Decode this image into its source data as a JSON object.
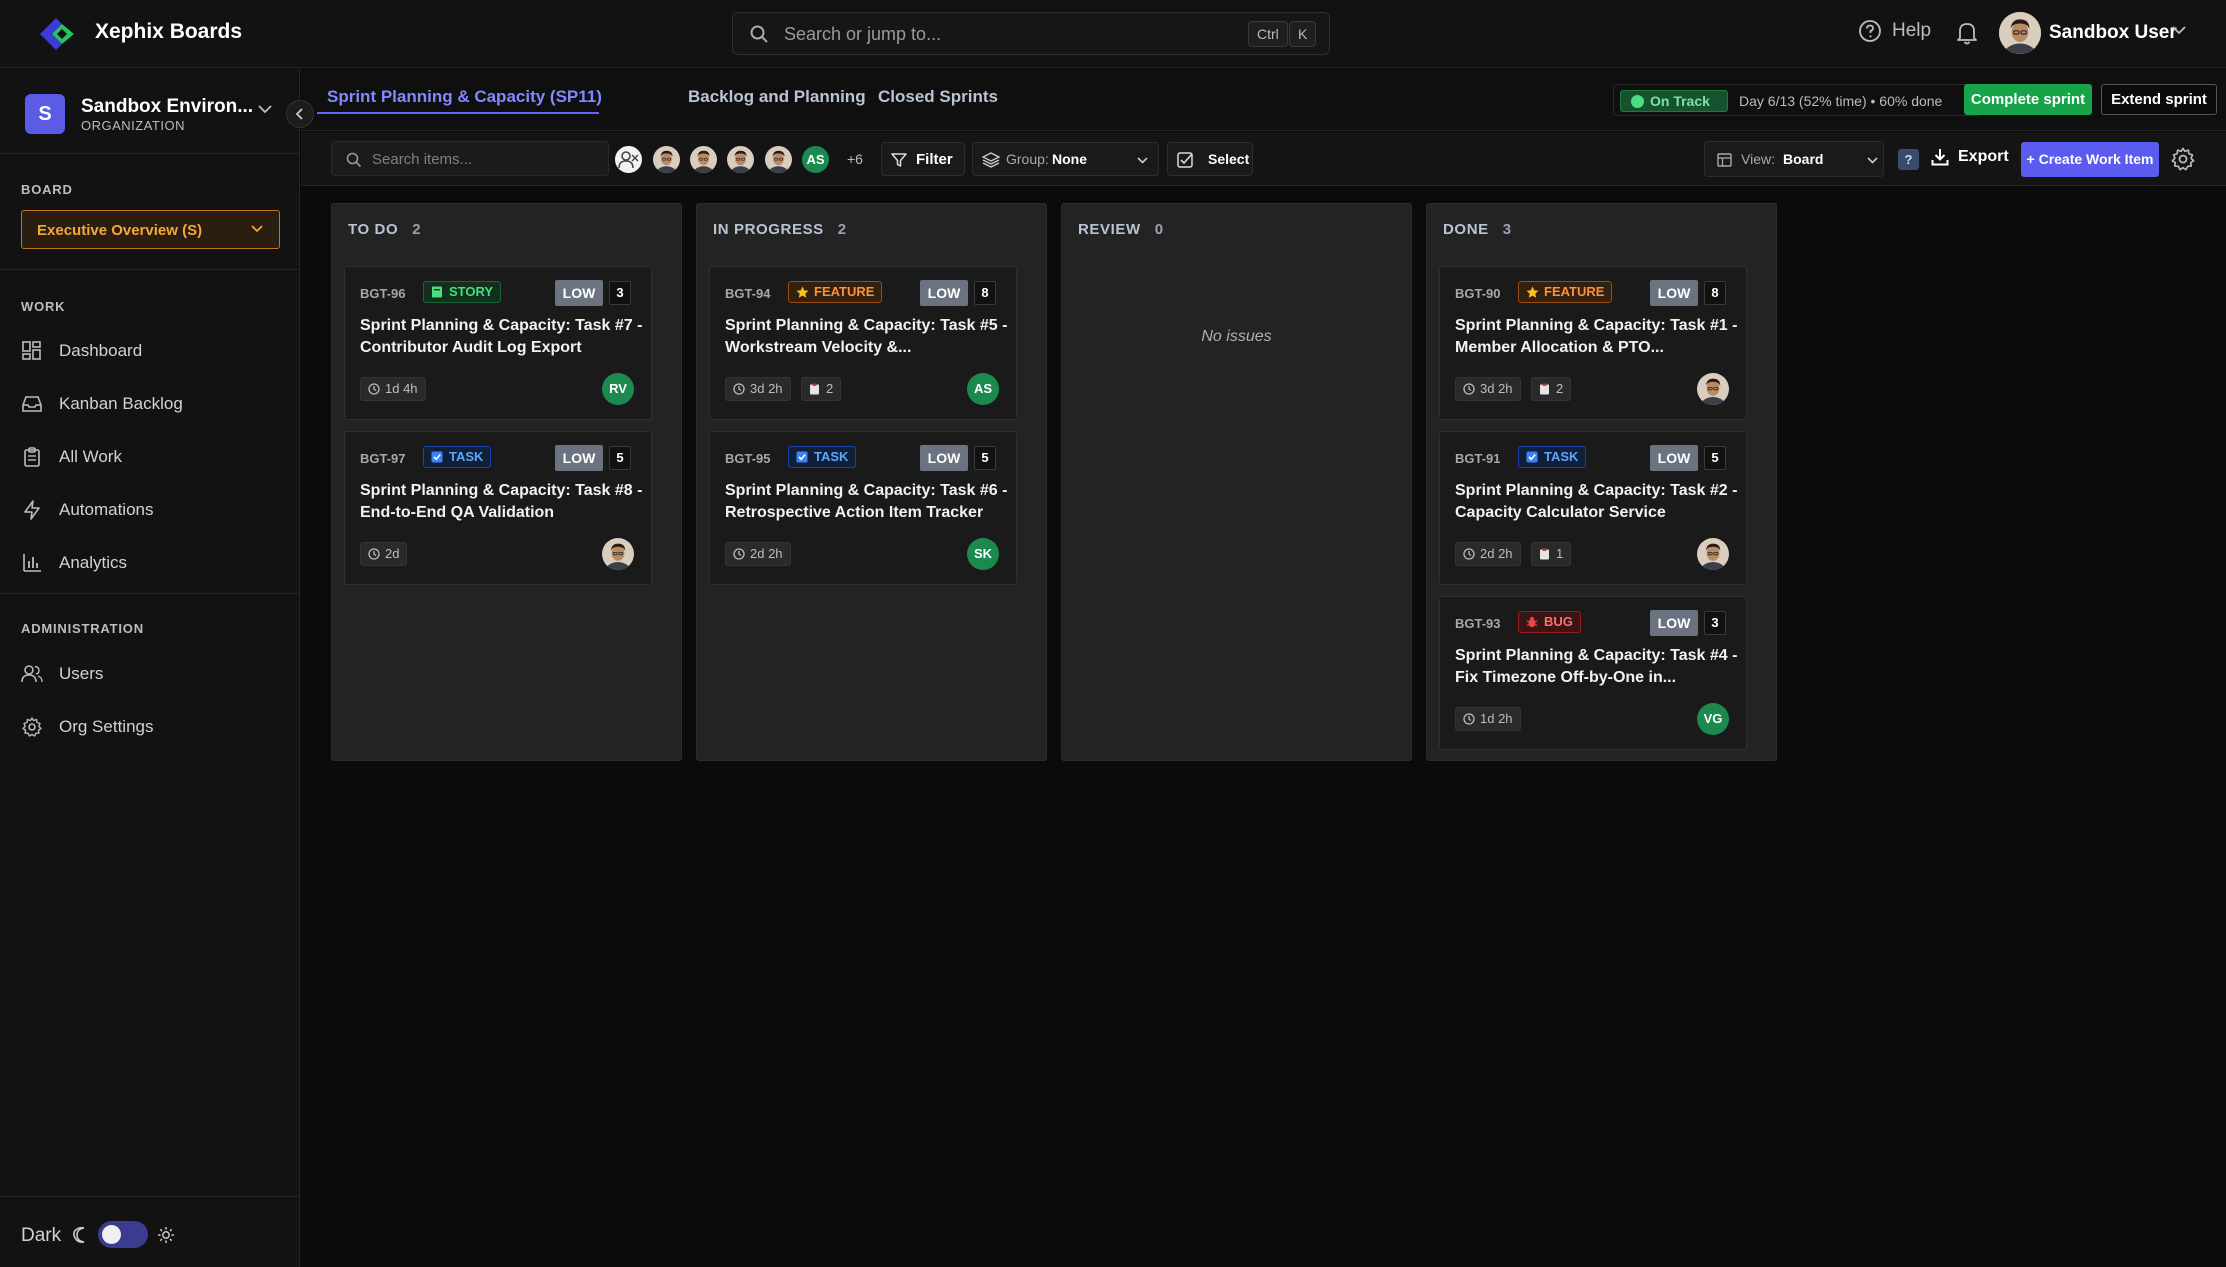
{
  "app": {
    "title": "Xephix Boards",
    "search_placeholder": "Search or jump to...",
    "shortcut_keys": [
      "Ctrl",
      "K"
    ],
    "help_label": "Help",
    "user_name": "Sandbox User"
  },
  "sidebar": {
    "org_initial": "S",
    "org_name": "Sandbox Environ...",
    "org_type": "ORGANIZATION",
    "board_label": "BOARD",
    "board_value": "Executive Overview (S)",
    "work_label": "WORK",
    "work_items": [
      {
        "label": "Dashboard",
        "icon": "dashboard-icon"
      },
      {
        "label": "Kanban Backlog",
        "icon": "inbox-icon"
      },
      {
        "label": "All Work",
        "icon": "clipboard-icon"
      },
      {
        "label": "Automations",
        "icon": "lightning-icon"
      },
      {
        "label": "Analytics",
        "icon": "bar-chart-icon"
      }
    ],
    "admin_label": "ADMINISTRATION",
    "admin_items": [
      {
        "label": "Users",
        "icon": "users-icon"
      },
      {
        "label": "Org Settings",
        "icon": "gear-icon"
      }
    ],
    "theme_label": "Dark"
  },
  "sprint": {
    "tabs": [
      "Sprint Planning & Capacity (SP11)",
      "Backlog and Planning",
      "Closed Sprints"
    ],
    "status_badge": "On Track",
    "status_text": "Day 6/13 (52% time) • 60% done",
    "complete_label": "Complete sprint",
    "extend_label": "Extend sprint"
  },
  "toolbar": {
    "search_placeholder": "Search items...",
    "avatar_initials": "AS",
    "more_count": "+6",
    "filter_label": "Filter",
    "group_label": "Group:",
    "group_value": "None",
    "select_label": "Select",
    "view_label": "View:",
    "view_value": "Board",
    "help_mark": "?",
    "export_label": "Export",
    "create_label": "+ Create Work Item"
  },
  "columns": [
    {
      "title": "TO DO",
      "count": "2",
      "cards": [
        {
          "key": "BGT-96",
          "type": "STORY",
          "priority": "LOW",
          "points": "3",
          "title": "Sprint Planning & Capacity: Task #7 - Contributor Audit Log Export",
          "estimate": "1d 4h",
          "avatar": "RV"
        },
        {
          "key": "BGT-97",
          "type": "TASK",
          "priority": "LOW",
          "points": "5",
          "title": "Sprint Planning & Capacity: Task #8 - End-to-End QA Validation",
          "estimate": "2d"
        }
      ]
    },
    {
      "title": "IN PROGRESS",
      "count": "2",
      "cards": [
        {
          "key": "BGT-94",
          "type": "FEATURE",
          "priority": "LOW",
          "points": "8",
          "title": "Sprint Planning & Capacity: Task #5 - Workstream Velocity &...",
          "estimate": "3d 2h",
          "subtasks": "2",
          "avatar": "AS"
        },
        {
          "key": "BGT-95",
          "type": "TASK",
          "priority": "LOW",
          "points": "5",
          "title": "Sprint Planning & Capacity: Task #6 - Retrospective Action Item Tracker",
          "estimate": "2d 2h",
          "avatar": "SK"
        }
      ]
    },
    {
      "title": "REVIEW",
      "count": "0",
      "empty_text": "No issues"
    },
    {
      "title": "DONE",
      "count": "3",
      "cards": [
        {
          "key": "BGT-90",
          "type": "FEATURE",
          "priority": "LOW",
          "points": "8",
          "title": "Sprint Planning & Capacity: Task #1 - Member Allocation & PTO...",
          "estimate": "3d 2h",
          "subtasks": "2"
        },
        {
          "key": "BGT-91",
          "type": "TASK",
          "priority": "LOW",
          "points": "5",
          "title": "Sprint Planning & Capacity: Task #2 - Capacity Calculator Service",
          "estimate": "2d 2h",
          "subtasks": "1"
        },
        {
          "key": "BGT-93",
          "type": "BUG",
          "priority": "LOW",
          "points": "3",
          "title": "Sprint Planning & Capacity: Task #4 - Fix Timezone Off-by-One in...",
          "estimate": "1d 2h",
          "avatar": "VG"
        }
      ]
    }
  ],
  "colors": {
    "accent": "#6366f1",
    "success": "#16a34a",
    "board_select": "#f4a73b",
    "priority_low": "#6b7280",
    "avatar_green": "#1c8a4f"
  }
}
